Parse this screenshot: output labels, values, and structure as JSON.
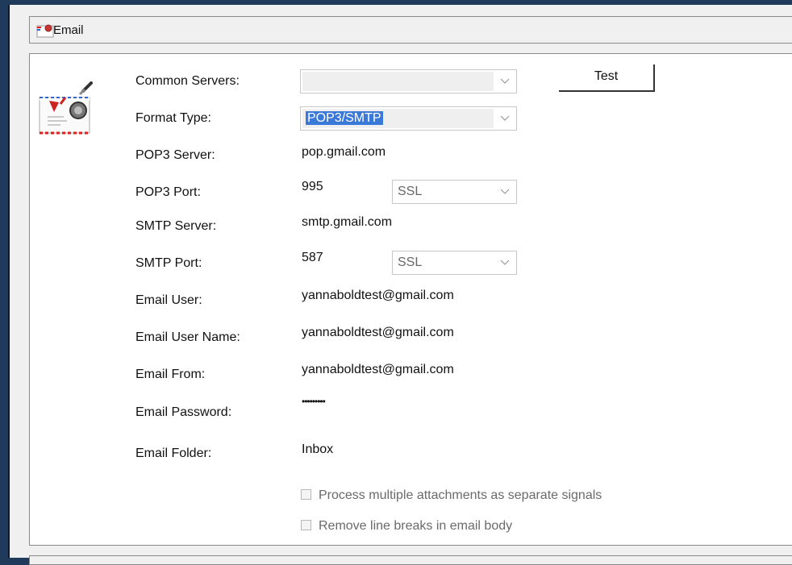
{
  "window": {
    "title": "Email"
  },
  "form": {
    "common_servers": {
      "label": "Common Servers:",
      "value": ""
    },
    "format_type": {
      "label": "Format Type:",
      "value": "POP3/SMTP"
    },
    "pop3_server": {
      "label": "POP3 Server:",
      "value": "pop.gmail.com"
    },
    "pop3_port": {
      "label": "POP3 Port:",
      "value": "995",
      "security": "SSL"
    },
    "smtp_server": {
      "label": "SMTP Server:",
      "value": "smtp.gmail.com"
    },
    "smtp_port": {
      "label": "SMTP Port:",
      "value": "587",
      "security": "SSL"
    },
    "email_user": {
      "label": "Email User:",
      "value": "yannaboldtest@gmail.com"
    },
    "email_user_name": {
      "label": "Email User Name:",
      "value": "yannaboldtest@gmail.com"
    },
    "email_from": {
      "label": "Email From:",
      "value": "yannaboldtest@gmail.com"
    },
    "email_password": {
      "label": "Email Password:",
      "value": "•••••••••"
    },
    "email_folder": {
      "label": "Email Folder:",
      "value": "Inbox"
    }
  },
  "buttons": {
    "test": "Test"
  },
  "options": {
    "separate_signals": {
      "label": "Process multiple attachments as separate signals",
      "checked": false
    },
    "remove_line_breaks": {
      "label": "Remove line breaks in email body",
      "checked": false
    }
  },
  "icons": {
    "title": "email-envelope-icon",
    "panel": "email-envelope-large-icon"
  },
  "colors": {
    "selection": "#3a79d8",
    "window_frame": "#1f3a5a"
  }
}
